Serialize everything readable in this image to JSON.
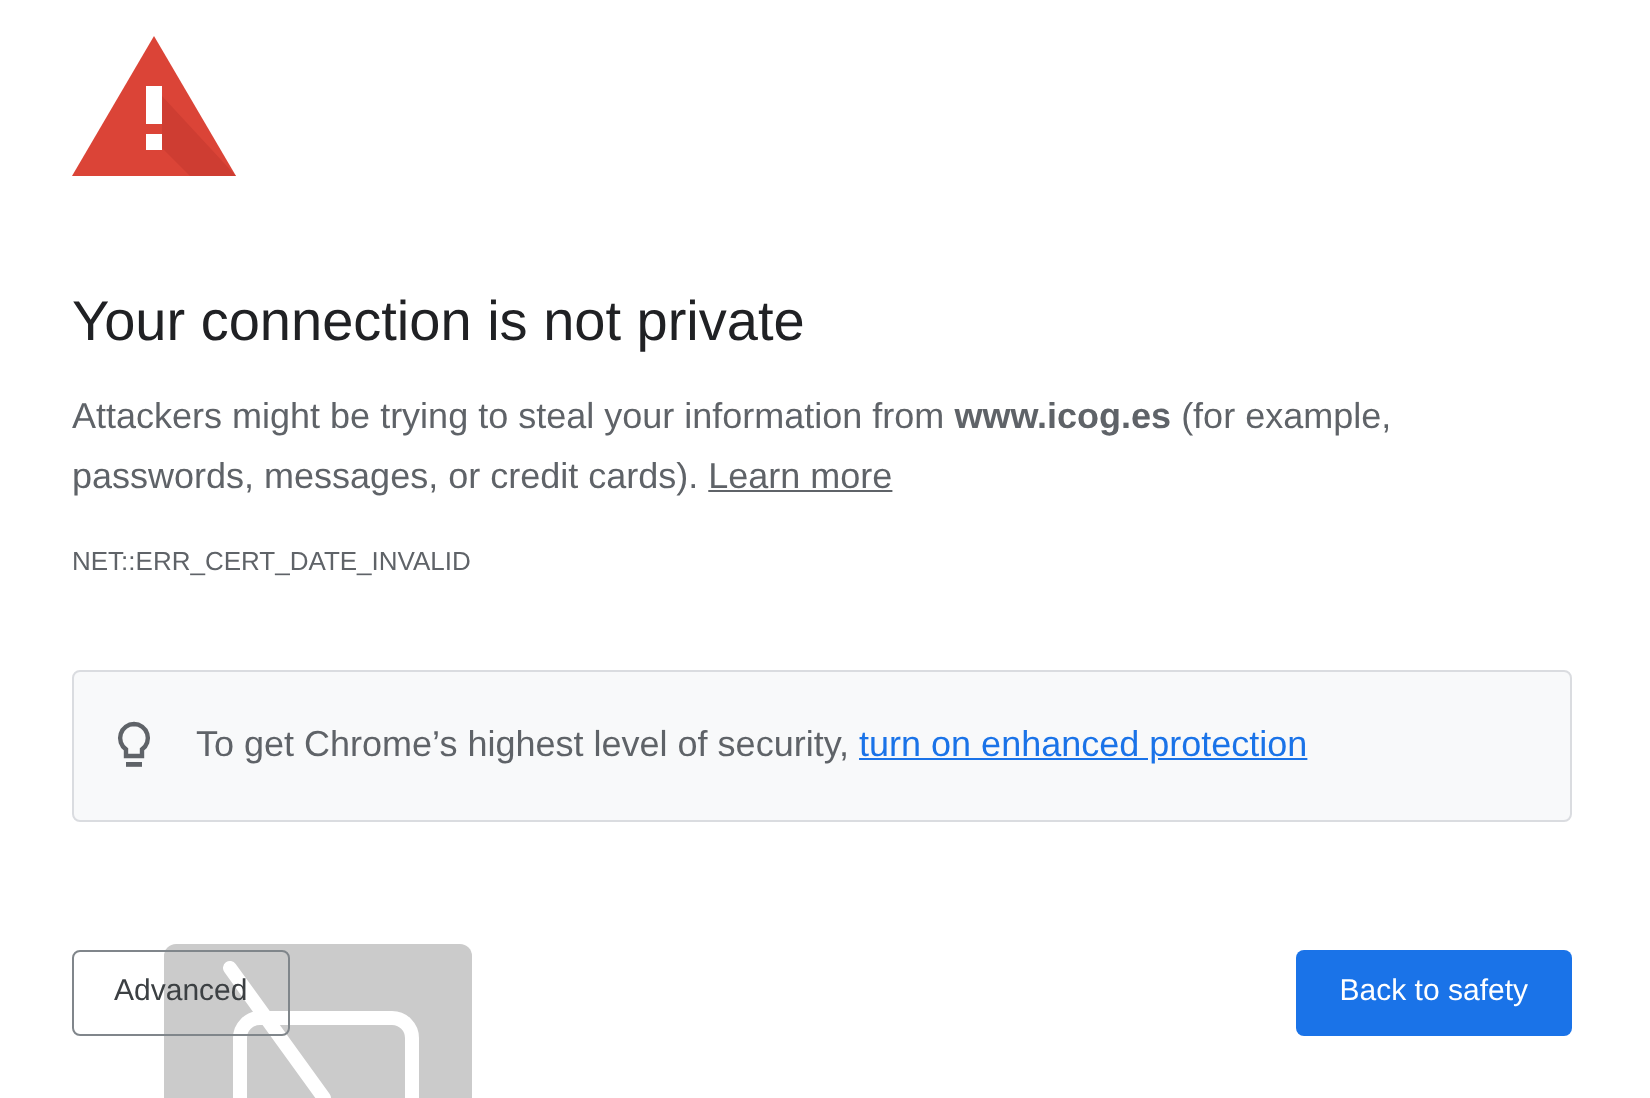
{
  "title": "Your connection is not private",
  "message": "Attackers might be trying to steal your information from **www.icog.es** (for example, passwords, messages, or credit cards).",
  "learn_more": "Learn more",
  "error_code": "NET::ERR_CERT_DATE_INVALID",
  "tip": {
    "text": "To get Chrome’s highest level of security,",
    "link": "turn on enhanced protection"
  },
  "buttons": [
    {
      "kind": "secondary",
      "label": "Advanced"
    },
    {
      "kind": "primary",
      "label": "Back to safety"
    }
  ]
}
